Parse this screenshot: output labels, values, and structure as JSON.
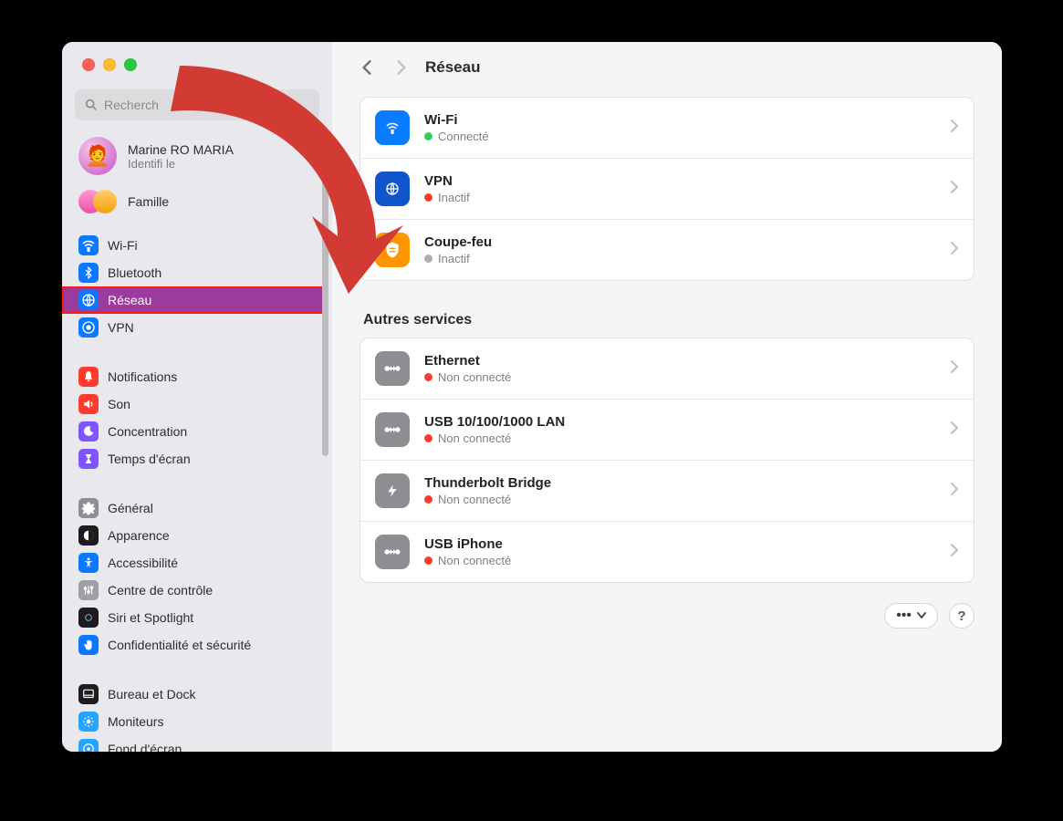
{
  "window": {
    "title": "Réseau"
  },
  "search": {
    "placeholder": "Recherch"
  },
  "account": {
    "name": "Marine       RO MARIA",
    "sub": "Identifi          le"
  },
  "family": {
    "label": "Famille"
  },
  "sidebar_group1": [
    {
      "icon": "wifi",
      "color": "blue",
      "label": "Wi-Fi"
    },
    {
      "icon": "bluetooth",
      "color": "blue",
      "label": "Bluetooth"
    },
    {
      "icon": "globe",
      "color": "blue",
      "label": "Réseau",
      "selected": true
    },
    {
      "icon": "vpn",
      "color": "blue",
      "label": "VPN"
    }
  ],
  "sidebar_group2": [
    {
      "icon": "bell",
      "color": "red",
      "label": "Notifications"
    },
    {
      "icon": "sound",
      "color": "red",
      "label": "Son"
    },
    {
      "icon": "moon",
      "color": "purple",
      "label": "Concentration"
    },
    {
      "icon": "hourglass",
      "color": "purple",
      "label": "Temps d'écran"
    }
  ],
  "sidebar_group3": [
    {
      "icon": "gear",
      "color": "gray",
      "label": "Général"
    },
    {
      "icon": "appearance",
      "color": "black",
      "label": "Apparence"
    },
    {
      "icon": "access",
      "color": "blue",
      "label": "Accessibilité"
    },
    {
      "icon": "control",
      "color": "control",
      "label": "Centre de contrôle"
    },
    {
      "icon": "siri",
      "color": "black",
      "label": "Siri et Spotlight"
    },
    {
      "icon": "hand",
      "color": "blue",
      "label": "Confidentialité et sécurité"
    }
  ],
  "sidebar_group4": [
    {
      "icon": "dock",
      "color": "black",
      "label": "Bureau et Dock"
    },
    {
      "icon": "display",
      "color": "cyan",
      "label": "Moniteurs"
    },
    {
      "icon": "wallpaper",
      "color": "cyan",
      "label": "Fond d'écran"
    }
  ],
  "network_primary": [
    {
      "icon": "wifi",
      "iconColor": "blue",
      "title": "Wi-Fi",
      "status": "Connecté",
      "statusColor": "green"
    },
    {
      "icon": "globe",
      "iconColor": "darkblue",
      "title": "VPN",
      "status": "Inactif",
      "statusColor": "red"
    },
    {
      "icon": "shield",
      "iconColor": "orange",
      "title": "Coupe-feu",
      "status": "Inactif",
      "statusColor": "gray"
    }
  ],
  "other_services_title": "Autres services",
  "other_services": [
    {
      "icon": "ethernet",
      "title": "Ethernet",
      "status": "Non connecté",
      "statusColor": "red"
    },
    {
      "icon": "ethernet",
      "title": "USB 10/100/1000 LAN",
      "status": "Non connecté",
      "statusColor": "red"
    },
    {
      "icon": "bolt",
      "title": "Thunderbolt Bridge",
      "status": "Non connecté",
      "statusColor": "red"
    },
    {
      "icon": "ethernet",
      "title": "USB iPhone",
      "status": "Non connecté",
      "statusColor": "red"
    }
  ]
}
